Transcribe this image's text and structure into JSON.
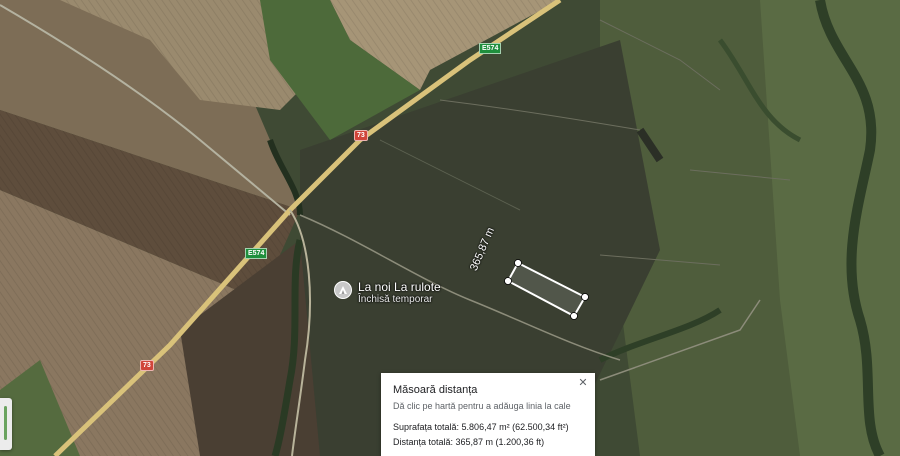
{
  "map": {
    "roads": [
      {
        "shield": "E574",
        "type": "european"
      },
      {
        "shield": "73",
        "type": "national"
      },
      {
        "shield": "E574",
        "type": "european"
      },
      {
        "shield": "73",
        "type": "national"
      }
    ],
    "poi": {
      "name": "La noi La rulote",
      "status": "Închisă temporar",
      "icon": "campground-icon"
    },
    "measurement": {
      "segment_label": "365,87 m"
    }
  },
  "measure_panel": {
    "title": "Măsoară distanța",
    "hint": "Dă clic pe hartă pentru a adăuga linia la cale",
    "area": "Suprafața totală: 5.806,47 m² (62.500,34 ft²)",
    "distance": "Distanța totală: 365,87 m (1.200,36 ft)",
    "close_icon": "close-icon"
  },
  "colors": {
    "road": "#d9c27a",
    "european_shield": "#1f8f3d",
    "national_shield": "#d0453a",
    "measure_line": "#ffffff"
  }
}
